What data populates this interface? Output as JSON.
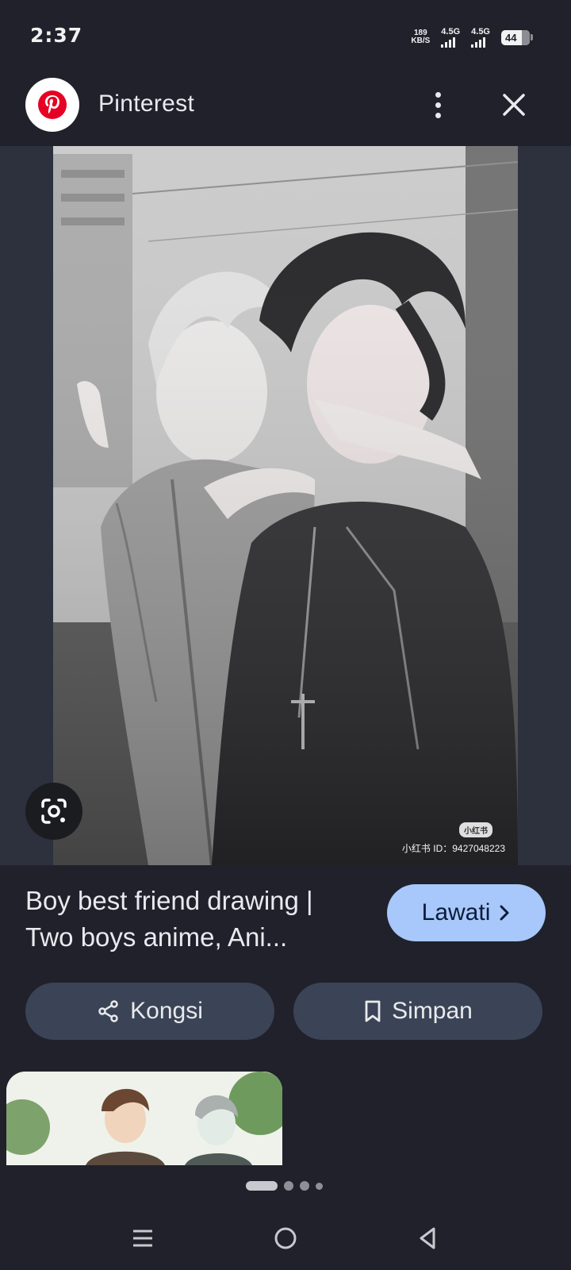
{
  "status_bar": {
    "time": "2:37",
    "net_speed_value": "189",
    "net_speed_unit": "KB/S",
    "sim1_label": "4.5G",
    "sim2_label": "4.5G",
    "battery_level": "44"
  },
  "header": {
    "title": "Pinterest",
    "logo_icon": "pinterest-logo-icon",
    "menu_icon": "more-vert-icon",
    "close_icon": "close-icon"
  },
  "image": {
    "watermark_badge": "小红书",
    "watermark_id": "小红书 ID：9427048223",
    "lens_icon": "google-lens-icon"
  },
  "result": {
    "title": "Boy best friend drawing | Two boys anime, Ani...",
    "visit_label": "Lawati",
    "share_label": "Kongsi",
    "save_label": "Simpan"
  },
  "pager": {
    "current": 1,
    "total": 4
  },
  "nav": {
    "recents_icon": "recents-icon",
    "home_icon": "home-icon",
    "back_icon": "back-icon"
  },
  "colors": {
    "background": "#20212b",
    "visit_button": "#a8c7fa",
    "action_button": "#3b4456",
    "pinterest_red": "#e60023"
  }
}
